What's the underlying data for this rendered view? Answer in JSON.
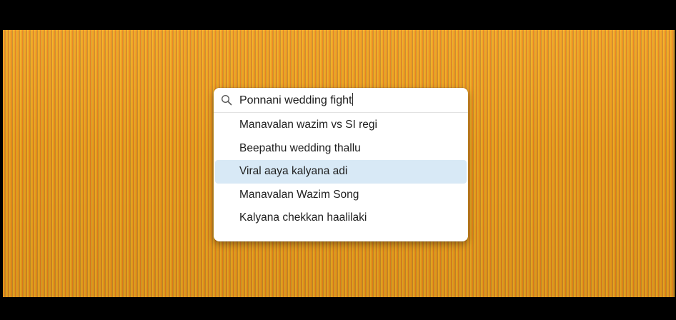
{
  "search": {
    "query": "Ponnani wedding fight"
  },
  "suggestions": [
    {
      "label": "Manavalan wazim vs SI regi",
      "highlighted": false
    },
    {
      "label": "Beepathu wedding thallu",
      "highlighted": false
    },
    {
      "label": "Viral aaya kalyana adi",
      "highlighted": true
    },
    {
      "label": "Manavalan Wazim Song",
      "highlighted": false
    },
    {
      "label": "Kalyana chekkan haalilaki",
      "highlighted": false
    }
  ],
  "colors": {
    "background_stripe_primary": "#f0a21c",
    "background_stripe_secondary": "#e9801f",
    "highlight": "#d8e9f6",
    "letterbox": "#000000"
  },
  "icons": {
    "search": "search-icon"
  }
}
